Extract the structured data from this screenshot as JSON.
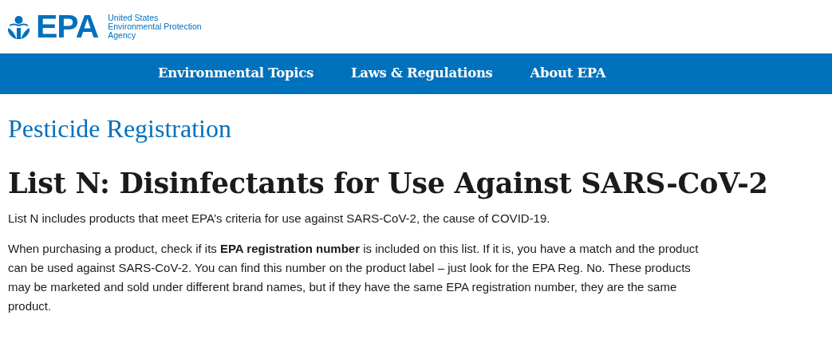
{
  "logo": {
    "wordmark": "EPA",
    "agency_lines": [
      "United States",
      "Environmental Protection",
      "Agency"
    ]
  },
  "nav": {
    "items": [
      {
        "label": "Environmental Topics"
      },
      {
        "label": "Laws & Regulations"
      },
      {
        "label": "About EPA"
      }
    ]
  },
  "section_title": "Pesticide Registration",
  "page_title": "List N: Disinfectants for Use Against SARS-CoV-2",
  "paragraphs": [
    "List N includes products that meet EPA’s criteria for use against SARS-CoV-2, the cause of COVID-19.",
    "When purchasing a product, check if its **EPA registration number** is included on this list. If it is, you have a match and the product can be used against SARS-CoV-2. You can find this number on the product label – just look for the EPA Reg. No. These products may be marketed and sold under different brand names, but if they have the same EPA registration number, they are the same product."
  ]
}
